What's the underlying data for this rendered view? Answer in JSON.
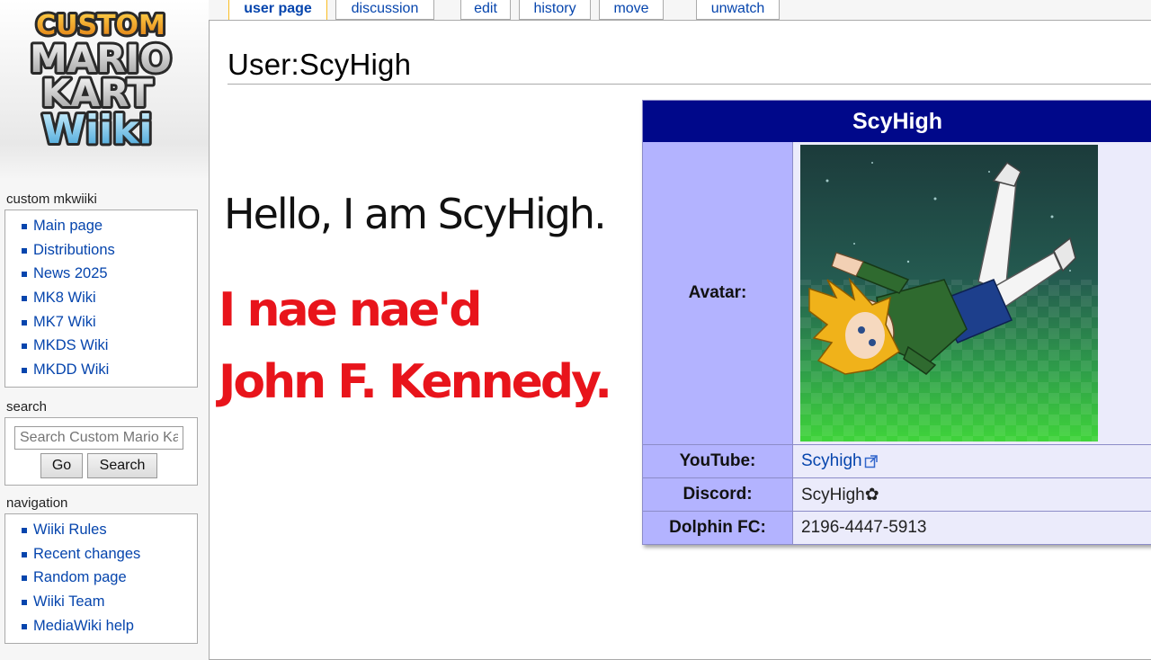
{
  "logo": {
    "line1": "CUSTOM",
    "line2": "MARIO",
    "line3": "KART",
    "line4": "Wiiki"
  },
  "tabs": {
    "user_page": "user page",
    "discussion": "discussion",
    "edit": "edit",
    "history": "history",
    "move": "move",
    "unwatch": "unwatch"
  },
  "page": {
    "title": "User:ScyHigh",
    "hello": "Hello, I am ScyHigh.",
    "red_line1": "I nae nae'd",
    "red_line2": "John F. Kennedy."
  },
  "infobox": {
    "name": "ScyHigh",
    "rows": [
      {
        "label": "Avatar:"
      },
      {
        "label": "YouTube:",
        "value": "Scyhigh"
      },
      {
        "label": "Discord:",
        "value": "ScyHigh✿"
      },
      {
        "label": "Dolphin FC:",
        "value": "2196-4447-5913"
      }
    ]
  },
  "sidebar": {
    "custom_heading": "custom mkwiiki",
    "custom_items": [
      "Main page",
      "Distributions",
      "News 2025",
      "MK8 Wiki",
      "MK7 Wiki",
      "MKDS Wiki",
      "MKDD Wiki"
    ],
    "search_heading": "search",
    "search_placeholder": "Search Custom Mario Kart",
    "go_label": "Go",
    "search_label": "Search",
    "nav_heading": "navigation",
    "nav_items": [
      "Wiiki Rules",
      "Recent changes",
      "Random page",
      "Wiiki Team",
      "MediaWiki help"
    ]
  },
  "colors": {
    "link": "#0645ad",
    "infobox_header": "#00088a",
    "infobox_label": "#b3b3ff",
    "infobox_value": "#ebebfb",
    "red_text": "#e8141b"
  }
}
